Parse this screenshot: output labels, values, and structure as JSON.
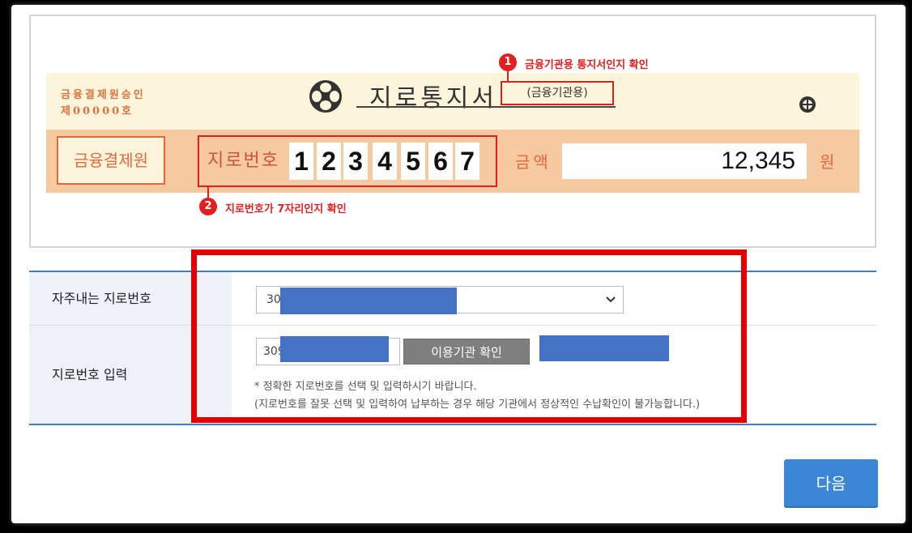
{
  "slip": {
    "approval_line1": "금융결제원승인",
    "approval_line2": "제00000호",
    "title": "지로통지서",
    "subtitle": "(금융기관용)",
    "settlement_org": "금융결제원",
    "giro_label": "지로번호",
    "giro_digits": [
      "1",
      "2",
      "3",
      "4",
      "5",
      "6",
      "7"
    ],
    "amount_label": "금액",
    "amount_value": "12,345",
    "currency_label": "원"
  },
  "callouts": [
    {
      "number": "1",
      "text": "금융기관용 통지서인지 확인"
    },
    {
      "number": "2",
      "text": "지로번호가 7자리인지 확인"
    }
  ],
  "form": {
    "favorites_label": "자주내는 지로번호",
    "favorites_value": "30",
    "input_label": "지로번호 입력",
    "input_value": "309",
    "verify_button": "이용기관 확인",
    "note_line1": "* 정확한 지로번호를 선택 및 입력하시기 바랍니다.",
    "note_line2": "(지로번호를 잘못 선택 및 입력하여 납부하는 경우 해당 기관에서 정상적인 수납확인이 불가능합니다.)"
  },
  "next_button": "다음",
  "colors": {
    "highlight": "#e50000",
    "mask": "#4472c4",
    "accent": "#3b87d6",
    "slip_orange": "#e06a3c"
  }
}
